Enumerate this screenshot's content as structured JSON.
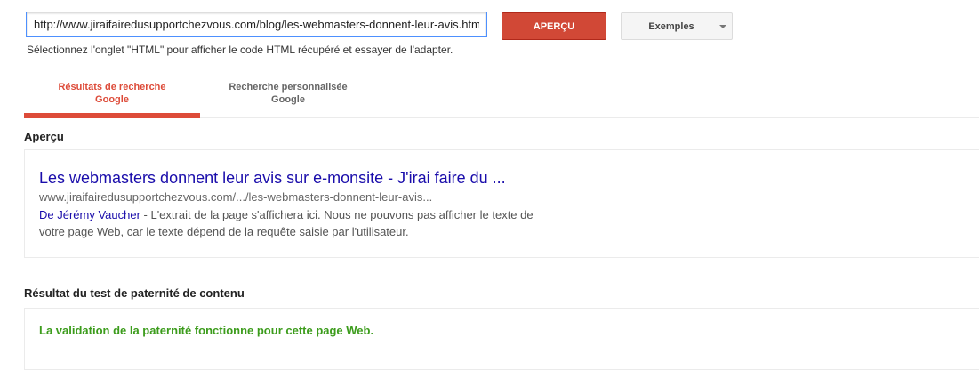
{
  "toolbar": {
    "url_value": "http://www.jiraifairedusupportchezvous.com/blog/les-webmasters-donnent-leur-avis.html",
    "hint": "Sélectionnez l'onglet \"HTML\" pour afficher le code HTML récupéré et essayer de l'adapter.",
    "preview_button": "APERÇU",
    "examples_button": "Exemples"
  },
  "tabs": [
    {
      "line1": "Résultats de recherche",
      "line2": "Google",
      "active": true
    },
    {
      "line1": "Recherche personnalisée",
      "line2": "Google",
      "active": false
    }
  ],
  "preview": {
    "heading": "Aperçu",
    "title": "Les webmasters donnent leur avis sur e-monsite - J'irai faire du ...",
    "url": "www.jiraifairedusupportchezvous.com/.../les-webmasters-donnent-leur-avis...",
    "author": "De Jérémy Vaucher",
    "snippet": " - L'extrait de la page s'affichera ici. Nous ne pouvons pas afficher le texte de votre page Web, car le texte dépend de la requête saisie par l'utilisateur."
  },
  "authorship": {
    "heading": "Résultat du test de paternité de contenu",
    "message": "La validation de la paternité fonctionne pour cette page Web."
  },
  "colors": {
    "accent_red": "#dd4b39",
    "link_blue": "#1a0dab",
    "success_green": "#3c9c1c"
  }
}
